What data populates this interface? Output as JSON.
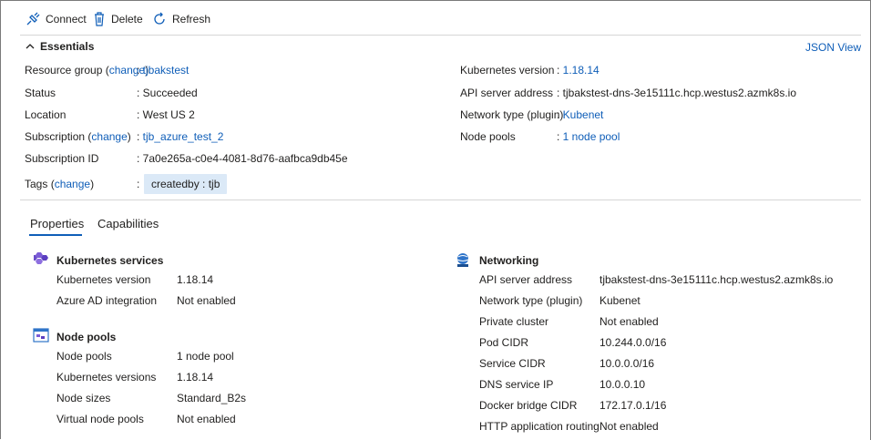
{
  "toolbar": {
    "connect": "Connect",
    "delete": "Delete",
    "refresh": "Refresh"
  },
  "essentials": {
    "title": "Essentials",
    "json_view": "JSON View",
    "change": "change",
    "left": {
      "resource_group_label": "Resource group",
      "resource_group_value": "tjbakstest",
      "status_label": "Status",
      "status_value": "Succeeded",
      "location_label": "Location",
      "location_value": "West US 2",
      "subscription_label": "Subscription",
      "subscription_value": "tjb_azure_test_2",
      "subscription_id_label": "Subscription ID",
      "subscription_id_value": "7a0e265a-c0e4-4081-8d76-aafbca9db45e",
      "tags_label": "Tags",
      "tag_value": "createdby : tjb"
    },
    "right": {
      "k8s_version_label": "Kubernetes version",
      "k8s_version_value": "1.18.14",
      "api_label": "API server address",
      "api_value": "tjbakstest-dns-3e15111c.hcp.westus2.azmk8s.io",
      "network_label": "Network type (plugin)",
      "network_value": "Kubenet",
      "node_pools_label": "Node pools",
      "node_pools_value": "1 node pool"
    }
  },
  "tabs": {
    "properties": "Properties",
    "capabilities": "Capabilities"
  },
  "properties": {
    "k8s_services": {
      "title": "Kubernetes services",
      "rows": [
        {
          "label": "Kubernetes version",
          "value": "1.18.14"
        },
        {
          "label": "Azure AD integration",
          "value": "Not enabled"
        }
      ]
    },
    "node_pools": {
      "title": "Node pools",
      "rows": [
        {
          "label": "Node pools",
          "value": "1 node pool"
        },
        {
          "label": "Kubernetes versions",
          "value": "1.18.14"
        },
        {
          "label": "Node sizes",
          "value": "Standard_B2s"
        },
        {
          "label": "Virtual node pools",
          "value": "Not enabled"
        }
      ]
    },
    "networking": {
      "title": "Networking",
      "rows": [
        {
          "label": "API server address",
          "value": "tjbakstest-dns-3e15111c.hcp.westus2.azmk8s.io"
        },
        {
          "label": "Network type (plugin)",
          "value": "Kubenet"
        },
        {
          "label": "Private cluster",
          "value": "Not enabled"
        },
        {
          "label": "Pod CIDR",
          "value": "10.244.0.0/16"
        },
        {
          "label": "Service CIDR",
          "value": "10.0.0.0/16"
        },
        {
          "label": "DNS service IP",
          "value": "10.0.0.10"
        },
        {
          "label": "Docker bridge CIDR",
          "value": "172.17.0.1/16"
        },
        {
          "label": "HTTP application routing",
          "value": "Not enabled"
        }
      ]
    }
  },
  "colors": {
    "link": "#0f5eb8",
    "tag_bg": "#dbe9f7",
    "tab_underline": "#0f5eb8"
  },
  "icons": [
    "connect-icon",
    "delete-icon",
    "refresh-icon",
    "chevron-up-icon",
    "kubernetes-services-icon",
    "node-pools-icon",
    "networking-icon"
  ]
}
